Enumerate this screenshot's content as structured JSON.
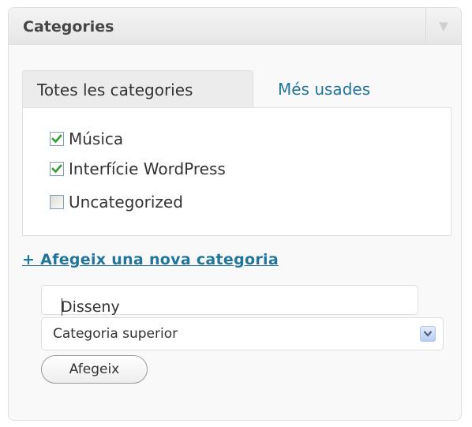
{
  "panel": {
    "title": "Categories"
  },
  "tabs": {
    "active_label": "Totes les categories",
    "other_label": "Més usades"
  },
  "categories": [
    {
      "label": "Música",
      "checked": true
    },
    {
      "label": "Interfície WordPress",
      "checked": true
    },
    {
      "label": "Uncategorized",
      "checked": false
    }
  ],
  "add_category": {
    "link_label": "+ Afegeix una nova categoria",
    "input_value": "Disseny",
    "parent_select_value": "Categoria superior",
    "button_label": "Afegeix"
  },
  "colors": {
    "link": "#21759b",
    "check": "#2f9e2f"
  }
}
